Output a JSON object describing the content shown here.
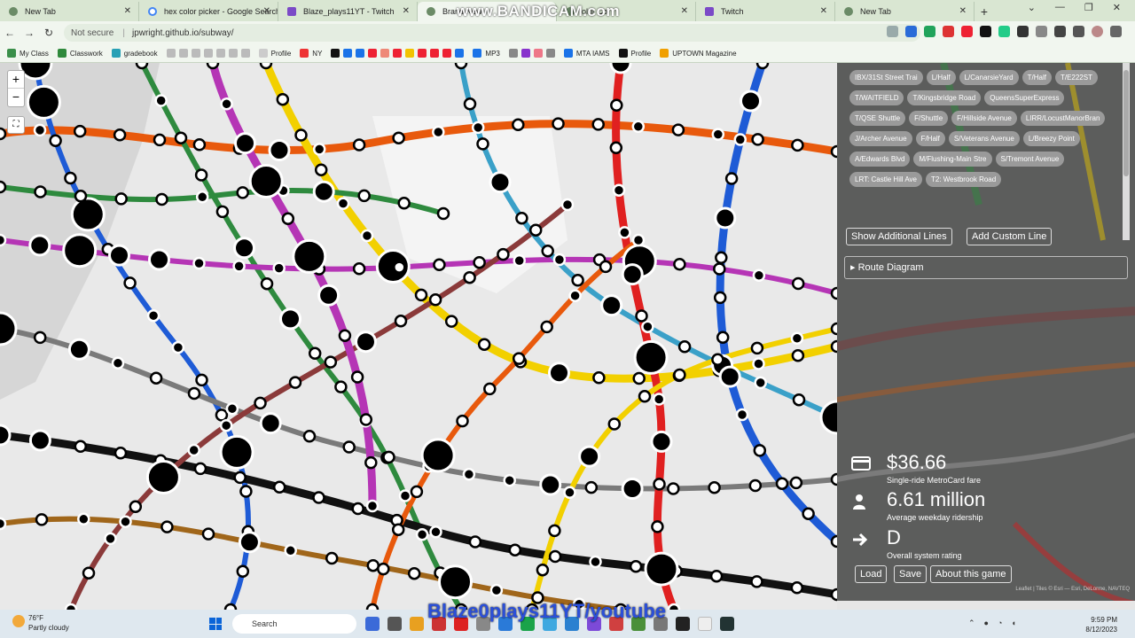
{
  "browser": {
    "tabs": [
      {
        "title": "New Tab",
        "favicon": "chrome-icon",
        "active": false
      },
      {
        "title": "hex color picker - Google Search",
        "favicon": "google-icon",
        "active": false
      },
      {
        "title": "Blaze_plays11YT - Twitch",
        "favicon": "twitch-icon",
        "active": false
      },
      {
        "title": "Brand New",
        "favicon": "chrome-icon",
        "active": true
      },
      {
        "title": "olor Co",
        "favicon": "chrome-icon",
        "active": false
      },
      {
        "title": "Twitch",
        "favicon": "twitch-icon",
        "active": false
      },
      {
        "title": "New Tab",
        "favicon": "chrome-icon",
        "active": false
      }
    ],
    "new_tab": "+",
    "watermark": "www.BANDICAM.com",
    "security": "Not secure",
    "url": "jpwright.github.io/subway/",
    "bookmarks": [
      "My Class",
      "Classwork",
      "gradebook",
      "Profile",
      "NY",
      "MP3",
      "MTA IAMS",
      "Profile",
      "UPTOWN Magazine"
    ]
  },
  "map": {
    "zoom_in": "+",
    "zoom_out": "−",
    "fullscreen": "⛶"
  },
  "panel": {
    "lines": [
      "IBX/31St Street Trai",
      "L/Half",
      "L/CanarsieYard",
      "T/Half",
      "T/E222ST",
      "T/WAITFIELD",
      "T/Kingsbridge Road",
      "QueensSuperExpress",
      "T/QSE Shuttle",
      "F/Shuttle",
      "F/Hillside Avenue",
      "LIRR/LocustManorBran",
      "J/Archer Avenue",
      "F/Half",
      "S/Veterans Avenue",
      "L/Breezy Point",
      "A/Edwards Blvd",
      "M/Flushing-Main Stre",
      "S/Tremont Avenue",
      "LRT: Castle Hill Ave",
      "T2: Westbrook Road"
    ],
    "show_additional": "Show Additional Lines",
    "add_custom": "Add Custom Line",
    "route_diagram": "▸ Route Diagram",
    "fare": {
      "value": "$36.66",
      "label": "Single-ride MetroCard fare"
    },
    "ridership": {
      "value": "6.61 million",
      "label": "Average weekday ridership"
    },
    "rating": {
      "value": "D",
      "label": "Overall system rating"
    },
    "load": "Load",
    "save": "Save",
    "about": "About this game",
    "attribution": "Leaflet | Tiles © Esri — Esri, DeLorme, NAVTEQ"
  },
  "taskbar": {
    "temp": "76°F",
    "weather": "Partly cloudy",
    "search": "Search",
    "overlay": "Blaze0plays11YT/youtube",
    "time": "9:59 PM",
    "date": "8/12/2023"
  }
}
